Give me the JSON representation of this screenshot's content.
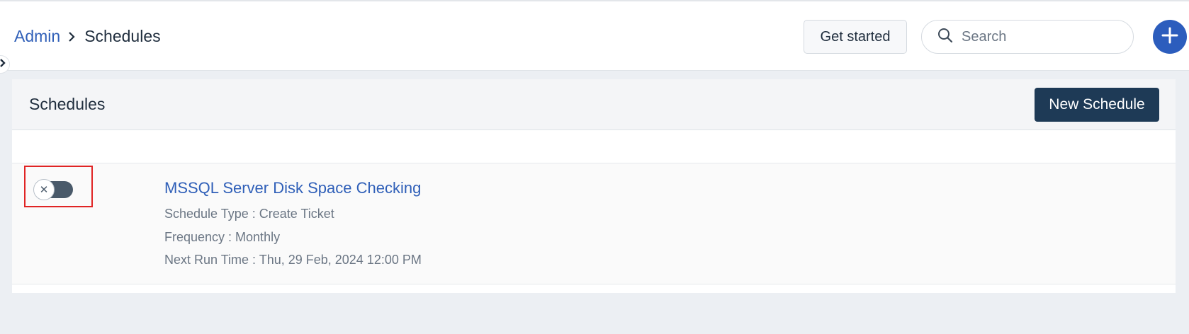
{
  "breadcrumb": {
    "parent": "Admin",
    "current": "Schedules"
  },
  "header": {
    "get_started_label": "Get started",
    "search_placeholder": "Search"
  },
  "panel": {
    "title": "Schedules",
    "new_schedule_label": "New Schedule"
  },
  "schedules": [
    {
      "title": "MSSQL Server Disk Space Checking",
      "type_line": "Schedule Type : Create Ticket",
      "frequency_line": "Frequency : Monthly",
      "next_run_line": "Next Run Time : Thu, 29 Feb, 2024 12:00 PM",
      "enabled": false,
      "toggle_icon": "x-icon"
    }
  ],
  "colors": {
    "accent": "#2c5dbd",
    "link": "#2f5fb8",
    "primary_button": "#1e3a56",
    "highlight": "#e02424"
  }
}
